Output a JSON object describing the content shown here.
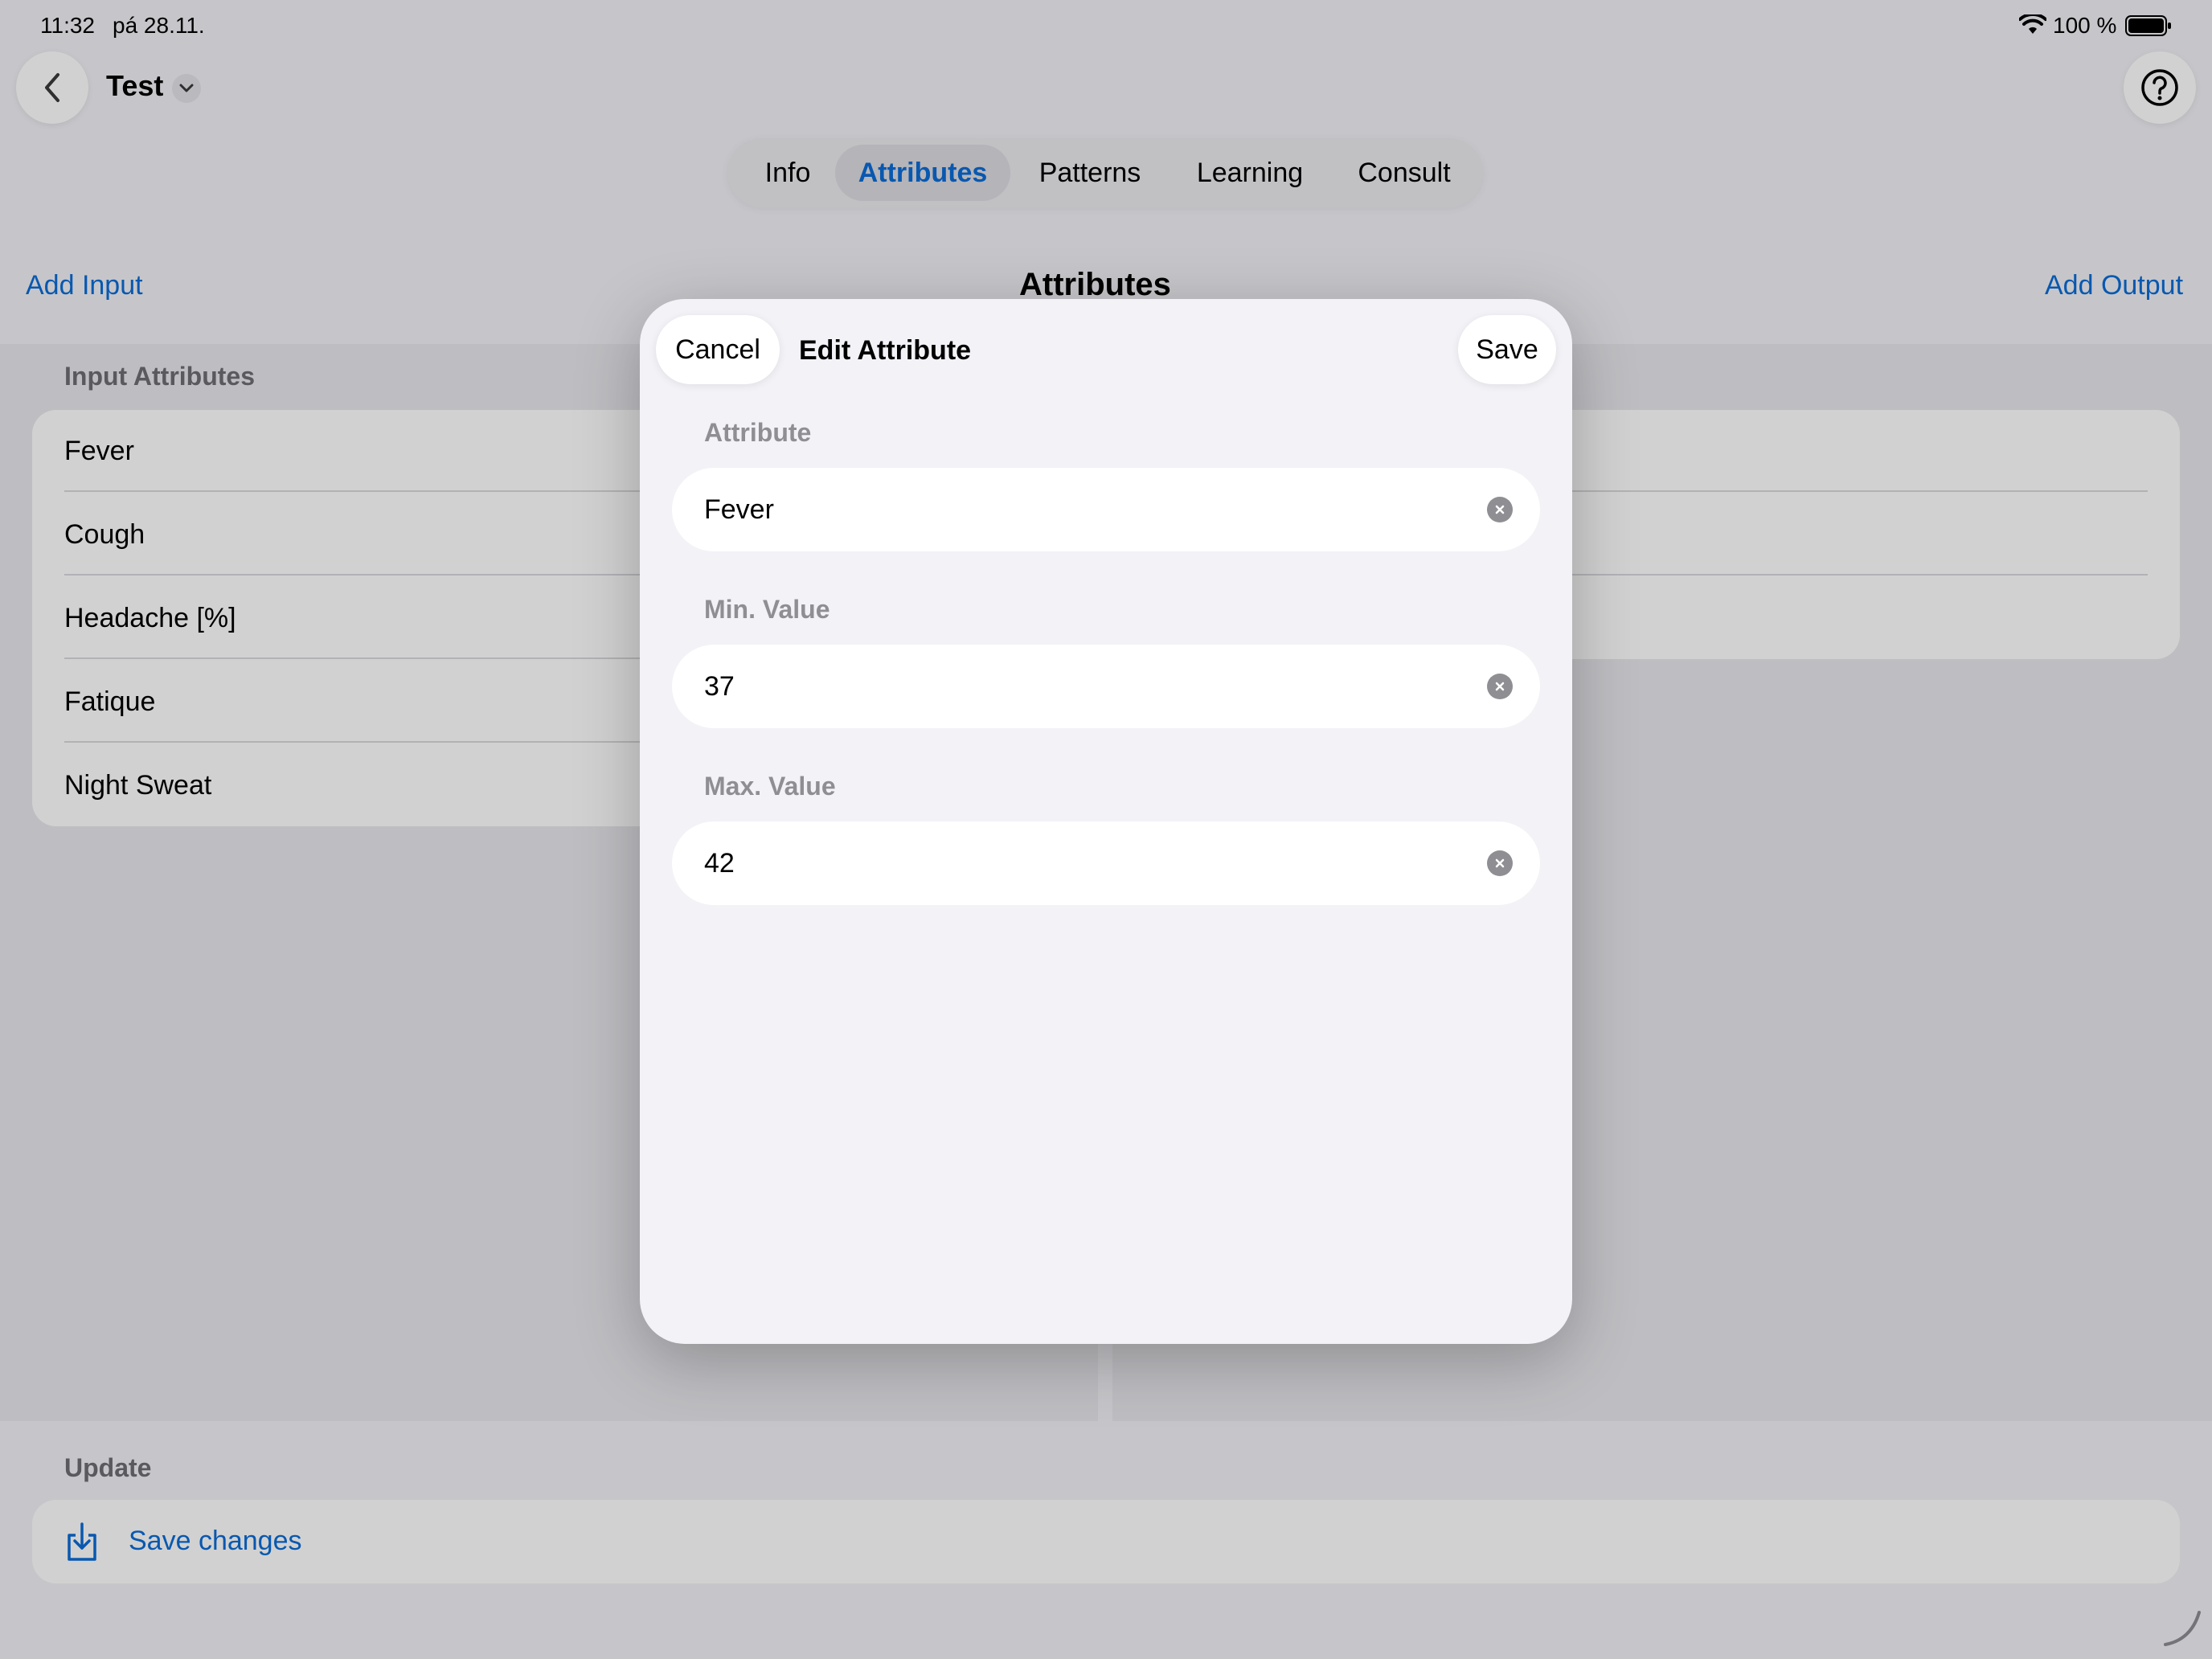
{
  "status_bar": {
    "time": "11:32",
    "date": "pá 28.11.",
    "battery_pct": "100 %"
  },
  "nav": {
    "title": "Test"
  },
  "tabs": [
    {
      "label": "Info",
      "active": false
    },
    {
      "label": "Attributes",
      "active": true
    },
    {
      "label": "Patterns",
      "active": false
    },
    {
      "label": "Learning",
      "active": false
    },
    {
      "label": "Consult",
      "active": false
    }
  ],
  "toolbar": {
    "add_input": "Add Input",
    "title": "Attributes",
    "add_output": "Add Output"
  },
  "inputs": {
    "section_label": "Input Attributes",
    "items": [
      "Fever",
      "Cough",
      "Headache [%]",
      "Fatique",
      "Night Sweat"
    ]
  },
  "update": {
    "section_label": "Update",
    "save_changes": "Save changes"
  },
  "sheet": {
    "cancel": "Cancel",
    "title": "Edit Attribute",
    "save": "Save",
    "attribute_label": "Attribute",
    "attribute_value": "Fever",
    "min_label": "Min. Value",
    "min_value": "37",
    "max_label": "Max. Value",
    "max_value": "42"
  },
  "colors": {
    "accent": "#0a6cd6",
    "background": "#f2f2f7",
    "card": "#ffffff",
    "secondary_text": "#8e8e93"
  }
}
